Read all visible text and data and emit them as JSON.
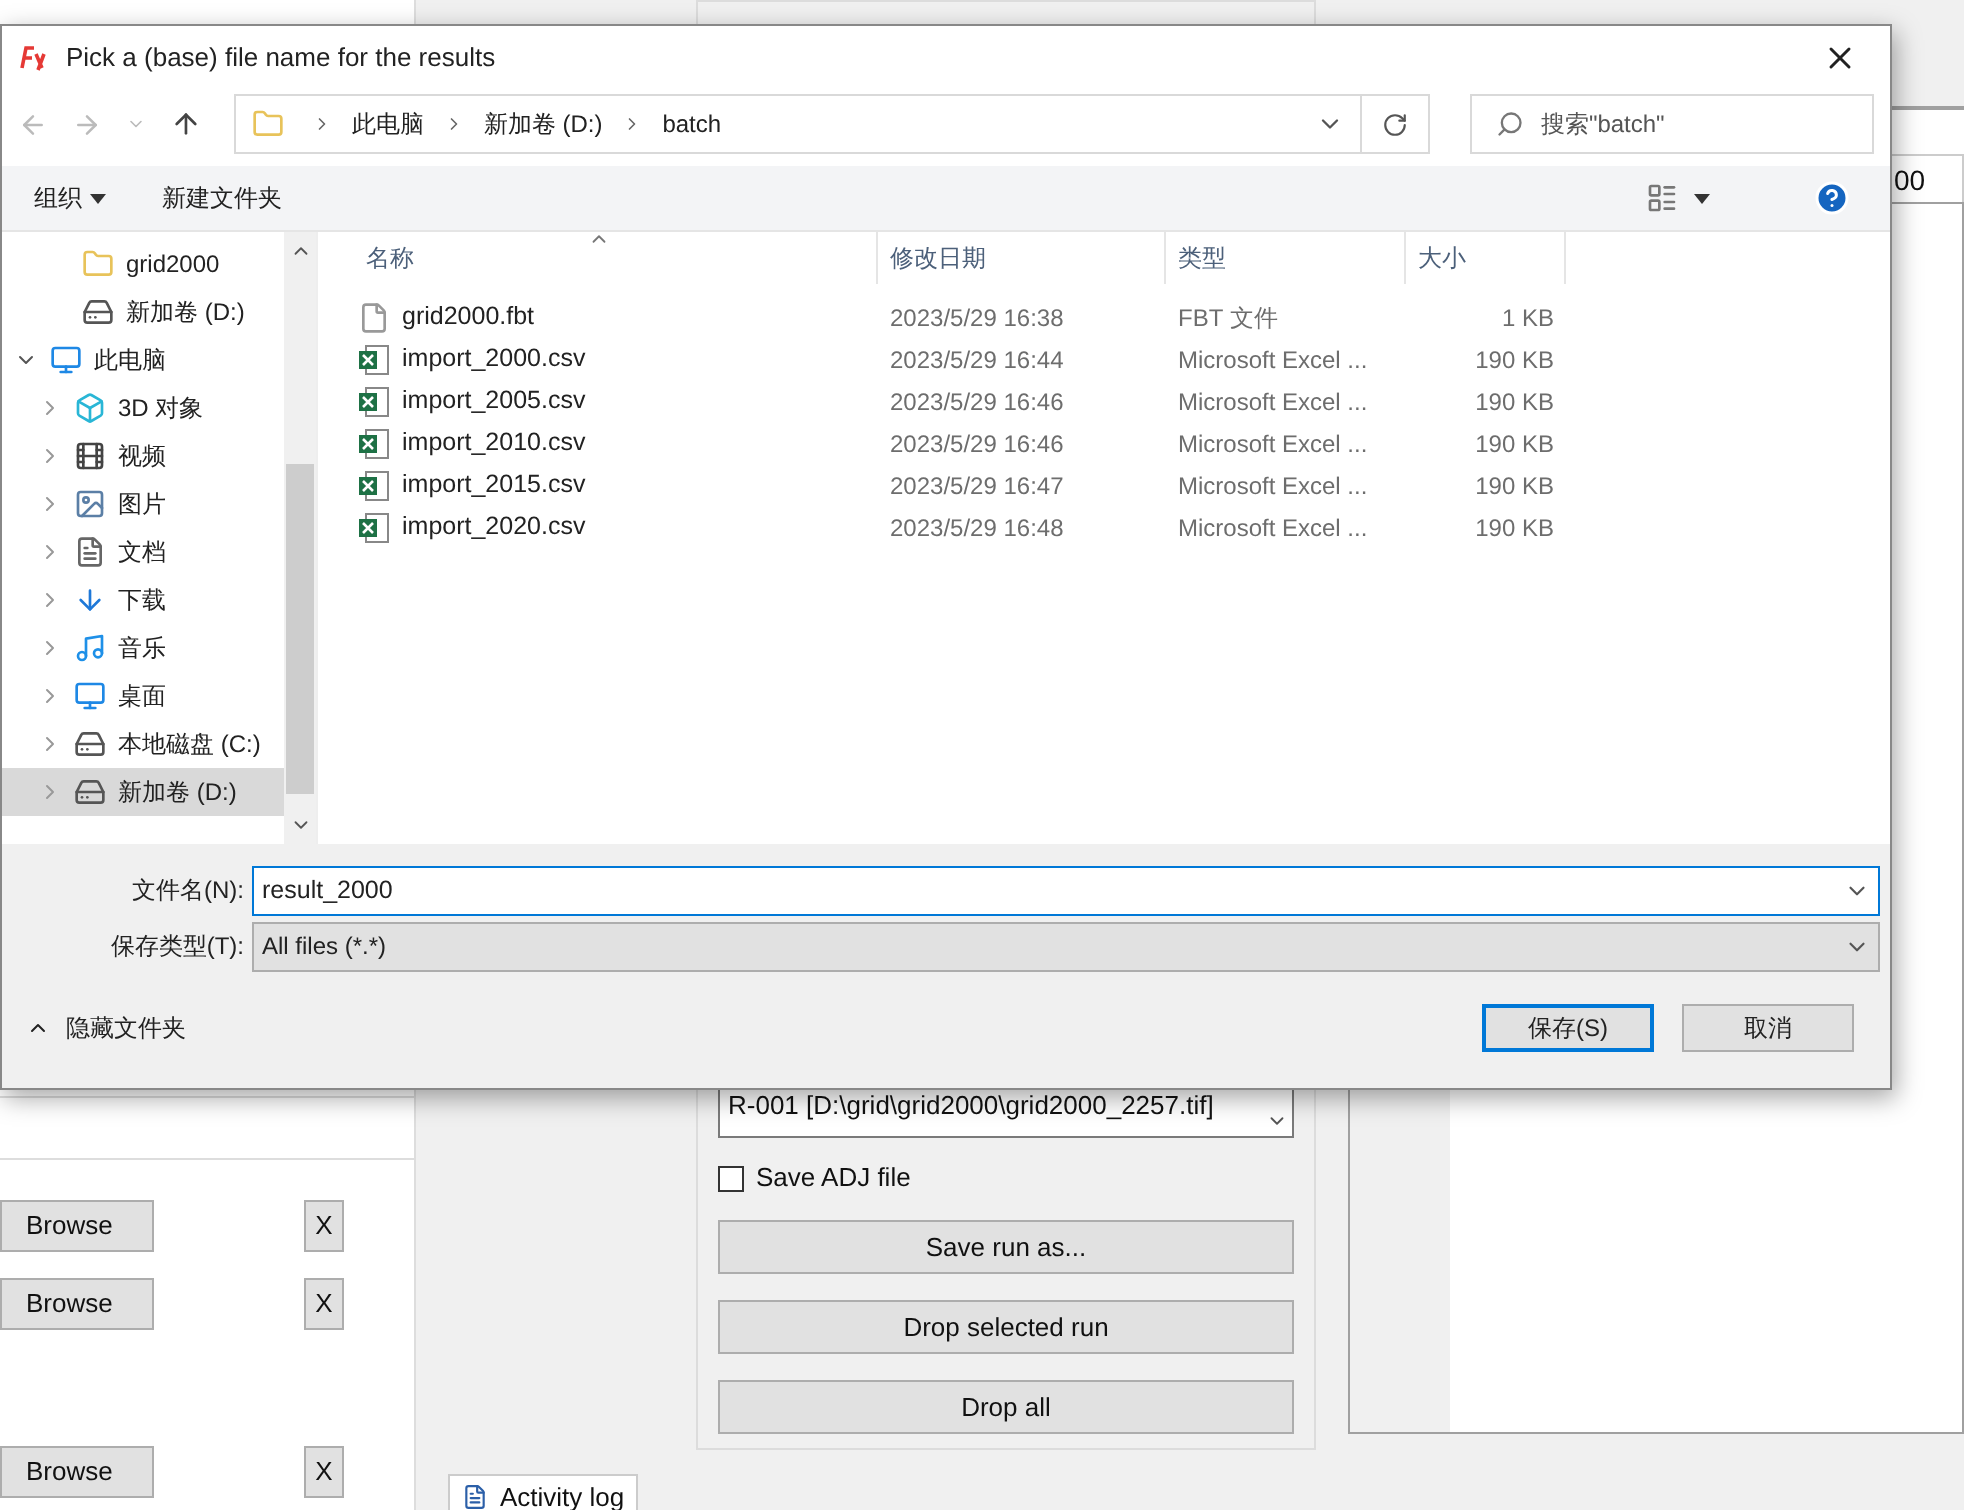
{
  "background": {
    "table_cell": "00",
    "file_rows": [
      {
        "button": "Browse",
        "remove": "X"
      },
      {
        "button": "Browse",
        "remove": "X"
      },
      {
        "button": "Browse",
        "remove": "X"
      }
    ],
    "run_list": [
      "R-001 [D:\\grid\\grid2000\\grid2000_2257.tif]"
    ],
    "save_adj": {
      "label": "Save ADJ file",
      "checked": false
    },
    "actions": [
      "Save run as...",
      "Drop selected run",
      "Drop all"
    ],
    "tab": "Activity log"
  },
  "dialog": {
    "title": "Pick a (base) file name for the results",
    "breadcrumb": [
      "此电脑",
      "新加卷 (D:)",
      "batch"
    ],
    "search": {
      "placeholder": "搜索\"batch\""
    },
    "toolbar": [
      "组织",
      "新建文件夹"
    ],
    "nav_pane": {
      "partial_items": [
        {
          "label": "grid2000",
          "kind": "folder",
          "selected": false
        },
        {
          "label": "新加卷 (D:)",
          "kind": "drive",
          "selected": false
        }
      ],
      "tree": [
        {
          "label": "此电脑",
          "kind": "pc",
          "expanded": true,
          "selected": false,
          "children": [
            {
              "label": "3D 对象",
              "kind": "cube",
              "expanded": false,
              "selected": false
            },
            {
              "label": "视频",
              "kind": "video",
              "expanded": false,
              "selected": false
            },
            {
              "label": "图片",
              "kind": "picture",
              "expanded": false,
              "selected": false
            },
            {
              "label": "文档",
              "kind": "document",
              "expanded": false,
              "selected": false
            },
            {
              "label": "下载",
              "kind": "download",
              "expanded": false,
              "selected": false
            },
            {
              "label": "音乐",
              "kind": "music",
              "expanded": false,
              "selected": false
            },
            {
              "label": "桌面",
              "kind": "desktop",
              "expanded": false,
              "selected": false
            },
            {
              "label": "本地磁盘 (C:)",
              "kind": "drive",
              "expanded": false,
              "selected": false
            },
            {
              "label": "新加卷 (D:)",
              "kind": "drive",
              "expanded": false,
              "selected": true
            }
          ]
        }
      ]
    },
    "columns": [
      "名称",
      "修改日期",
      "类型",
      "大小"
    ],
    "rows": [
      {
        "kind": "file",
        "name": "grid2000.fbt",
        "date": "2023/5/29 16:38",
        "type": "FBT 文件",
        "size": "1 KB"
      },
      {
        "kind": "excel",
        "name": "import_2000.csv",
        "date": "2023/5/29 16:44",
        "type": "Microsoft Excel ...",
        "size": "190 KB"
      },
      {
        "kind": "excel",
        "name": "import_2005.csv",
        "date": "2023/5/29 16:46",
        "type": "Microsoft Excel ...",
        "size": "190 KB"
      },
      {
        "kind": "excel",
        "name": "import_2010.csv",
        "date": "2023/5/29 16:46",
        "type": "Microsoft Excel ...",
        "size": "190 KB"
      },
      {
        "kind": "excel",
        "name": "import_2015.csv",
        "date": "2023/5/29 16:47",
        "type": "Microsoft Excel ...",
        "size": "190 KB"
      },
      {
        "kind": "excel",
        "name": "import_2020.csv",
        "date": "2023/5/29 16:48",
        "type": "Microsoft Excel ...",
        "size": "190 KB"
      }
    ],
    "file_name": {
      "label": "文件名(N):",
      "value": "result_2000"
    },
    "file_type": {
      "label": "保存类型(T):",
      "value": "All files (*.*)"
    },
    "hide_folders": "隐藏文件夹",
    "buttons": [
      "保存(S)",
      "取消"
    ]
  }
}
